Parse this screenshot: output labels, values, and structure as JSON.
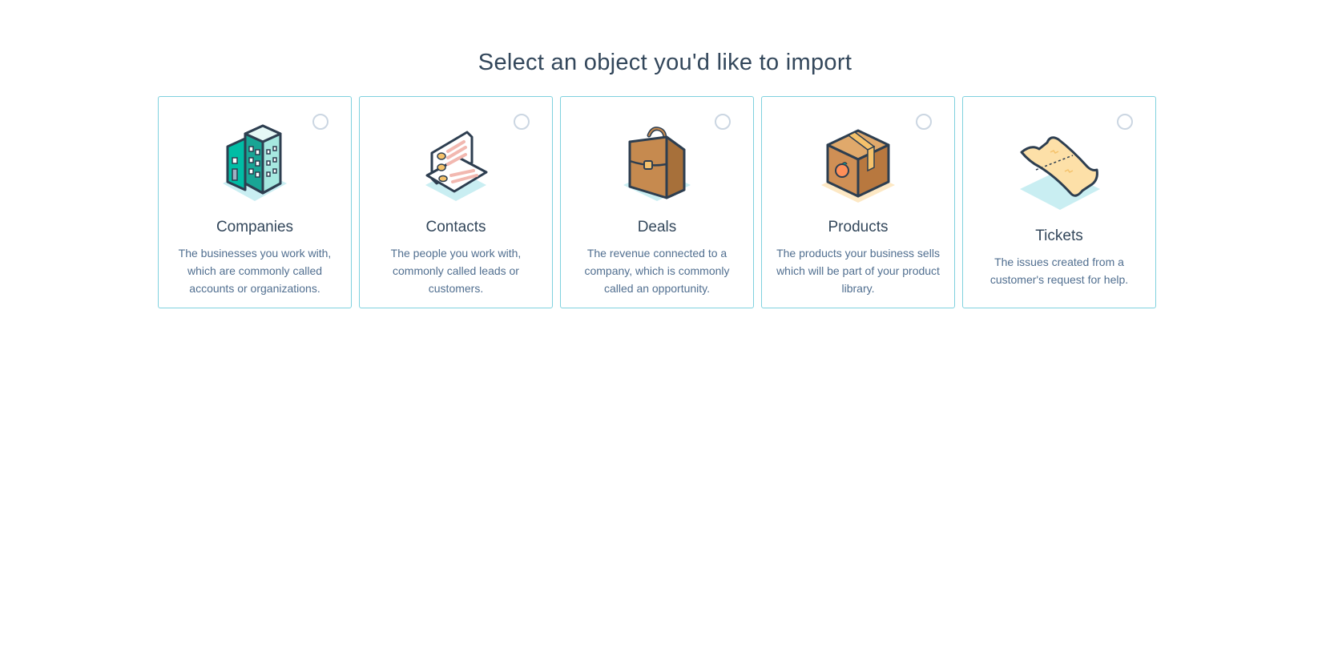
{
  "page": {
    "title": "Select an object you'd like to import"
  },
  "colors": {
    "card_border": "#7fd1de",
    "radio_border": "#cbd6e2",
    "title_text": "#33475b",
    "desc_text": "#516f90"
  },
  "cards": [
    {
      "title": "Companies",
      "description": "The businesses you work with, which are commonly called accounts or organizations.",
      "icon": "building-icon"
    },
    {
      "title": "Contacts",
      "description": "The people you work with, commonly called leads or customers.",
      "icon": "contact-cards-icon"
    },
    {
      "title": "Deals",
      "description": "The revenue connected to a company, which is commonly called an opportunity.",
      "icon": "briefcase-icon"
    },
    {
      "title": "Products",
      "description": "The products your business sells which will be part of your product library.",
      "icon": "box-icon"
    },
    {
      "title": "Tickets",
      "description": "The issues created from a customer's request for help.",
      "icon": "ticket-icon"
    }
  ]
}
